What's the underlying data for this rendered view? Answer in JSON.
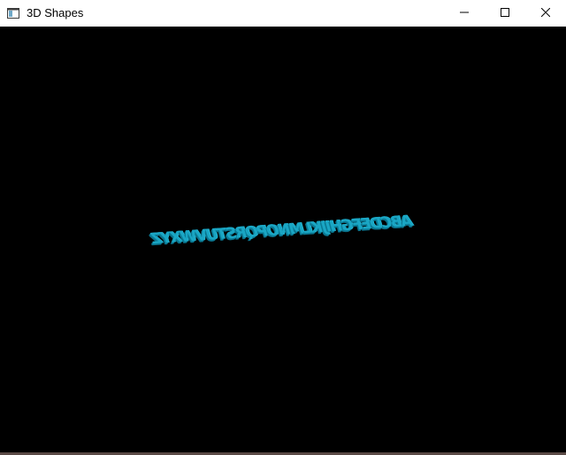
{
  "window": {
    "title": "3D Shapes",
    "app_icon": "window-app-icon"
  },
  "controls": {
    "minimize_icon": "minimize-icon",
    "maximize_icon": "maximize-icon",
    "close_icon": "close-icon"
  },
  "scene": {
    "text": "ABCDEFGHIJKLMNOPQRSTUVWXYZ",
    "text_color": "#1aa6c4",
    "background_color": "#000000"
  }
}
